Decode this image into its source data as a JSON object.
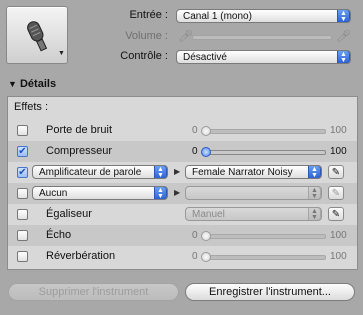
{
  "instrument": {
    "icon": "microphone-icon"
  },
  "labels": {
    "entree": "Entrée :",
    "volume": "Volume :",
    "controle": "Contrôle :"
  },
  "entree_value": "Canal 1 (mono)",
  "controle_value": "Désactivé",
  "details": {
    "title": "Détails",
    "effets": "Effets :"
  },
  "rows": {
    "porte": {
      "name": "Porte de bruit",
      "min": "0",
      "max": "100",
      "level": 0
    },
    "compresseur": {
      "name": "Compresseur",
      "min": "0",
      "max": "100",
      "level": 0
    },
    "amplificateur": {
      "name": "Amplificateur de parole",
      "preset": "Female Narrator Noisy"
    },
    "aucun": {
      "name": "Aucun"
    },
    "egaliseur": {
      "name": "Égaliseur",
      "preset": "Manuel"
    },
    "echo": {
      "name": "Écho",
      "min": "0",
      "max": "100",
      "level": 0
    },
    "reverb": {
      "name": "Réverbération",
      "min": "0",
      "max": "100",
      "level": 0
    }
  },
  "buttons": {
    "supprimer": "Supprimer l'instrument",
    "enregistrer": "Enregistrer l'instrument..."
  }
}
